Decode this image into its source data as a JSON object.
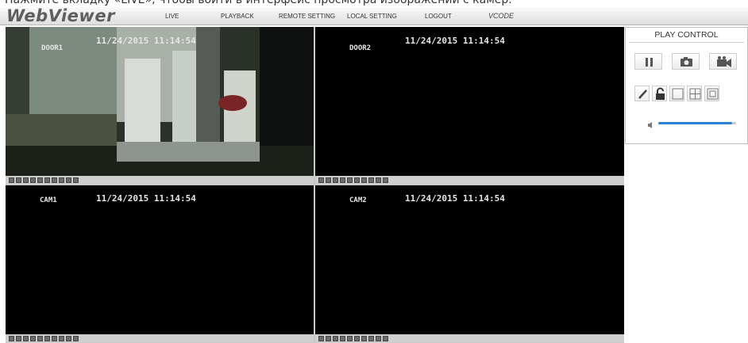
{
  "caption": "Нажмите вкладку «LIVE», чтобы войти в интерфейс просмотра изображений с камер.",
  "app": {
    "brand": "WebViewer",
    "vendor_logo": "VCODE"
  },
  "nav": [
    {
      "label": "LIVE"
    },
    {
      "label": "PLAYBACK"
    },
    {
      "label": "REMOTE SETTING"
    },
    {
      "label": "LOCAL SETTING"
    },
    {
      "label": "LOGOUT"
    }
  ],
  "cameras": [
    {
      "name": "DOOR1",
      "timestamp": "11/24/2015 11:14:54"
    },
    {
      "name": "DOOR2",
      "timestamp": "11/24/2015 11:14:54"
    },
    {
      "name": "CAM1",
      "timestamp": "11/24/2015 11:14:54"
    },
    {
      "name": "CAM2",
      "timestamp": "11/24/2015 11:14:54"
    }
  ],
  "play_control": {
    "title": "PLAY CONTROL",
    "icons": [
      "pause-icon",
      "snapshot-icon",
      "record-icon",
      "pen-icon",
      "unlock-icon",
      "single-view-icon",
      "quad-view-icon",
      "fullscreen-icon",
      "speaker-icon"
    ],
    "volume": 0.95
  },
  "colors": {
    "accent": "#2e82d6",
    "feed_bg": "#000000"
  }
}
